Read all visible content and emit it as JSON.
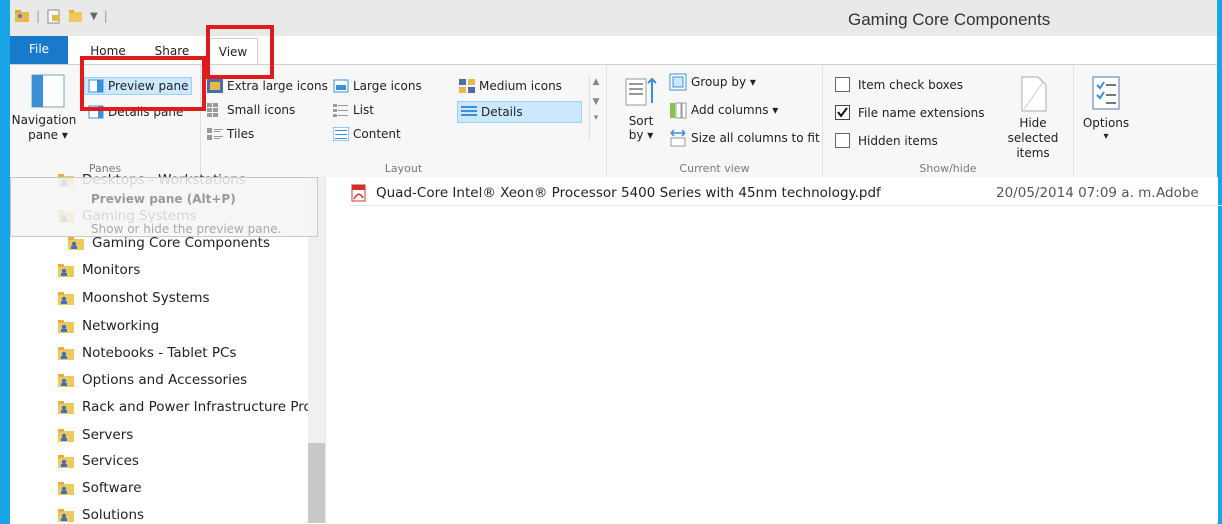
{
  "window": {
    "title": "Gaming Core Components"
  },
  "tabs": {
    "file": "File",
    "home": "Home",
    "share": "Share",
    "view": "View"
  },
  "ribbon": {
    "panes": {
      "label": "Panes",
      "navigation_pane_line1": "Navigation",
      "navigation_pane_line2": "pane ▾",
      "preview_pane": "Preview pane",
      "details_pane": "Details pane"
    },
    "layout": {
      "label": "Layout",
      "items": [
        "Extra large icons",
        "Large icons",
        "Medium icons",
        "Small icons",
        "List",
        "Details",
        "Tiles",
        "Content"
      ]
    },
    "current_view": {
      "label": "Current view",
      "sort_line1": "Sort",
      "sort_line2": "by ▾",
      "group_by": "Group by ▾",
      "add_columns": "Add columns ▾",
      "size_all_columns": "Size all columns to fit"
    },
    "show_hide": {
      "label": "Show/hide",
      "item_check_boxes": {
        "label": "Item check boxes",
        "checked": false
      },
      "file_name_extensions": {
        "label": "File name extensions",
        "checked": true
      },
      "hidden_items": {
        "label": "Hidden items",
        "checked": false
      },
      "hide_selected_line1": "Hide selected",
      "hide_selected_line2": "items"
    },
    "options": {
      "line1": "Options",
      "line2": "▾"
    }
  },
  "tooltip": {
    "title": "Preview pane (Alt+P)",
    "description": "Show or hide the preview pane."
  },
  "nav": {
    "items": [
      "Desktops - Workstations",
      "Gaming Systems",
      "Gaming Core Components",
      "Monitors",
      "Moonshot Systems",
      "Networking",
      "Notebooks - Tablet PCs",
      "Options and Accessories",
      "Rack and Power Infrastructure Products",
      "Servers",
      "Services",
      "Software",
      "Solutions"
    ]
  },
  "files": [
    {
      "name": "Quad-Core Intel® Xeon® Processor 5400 Series with 45nm technology.pdf",
      "date": "20/05/2014 07:09 a. m.",
      "type": "Adobe"
    }
  ],
  "colors": {
    "accent": "#1aa4e8",
    "file_tab": "#1979ca",
    "highlight_red": "#e01b1b",
    "selected": "#cce8ff"
  }
}
